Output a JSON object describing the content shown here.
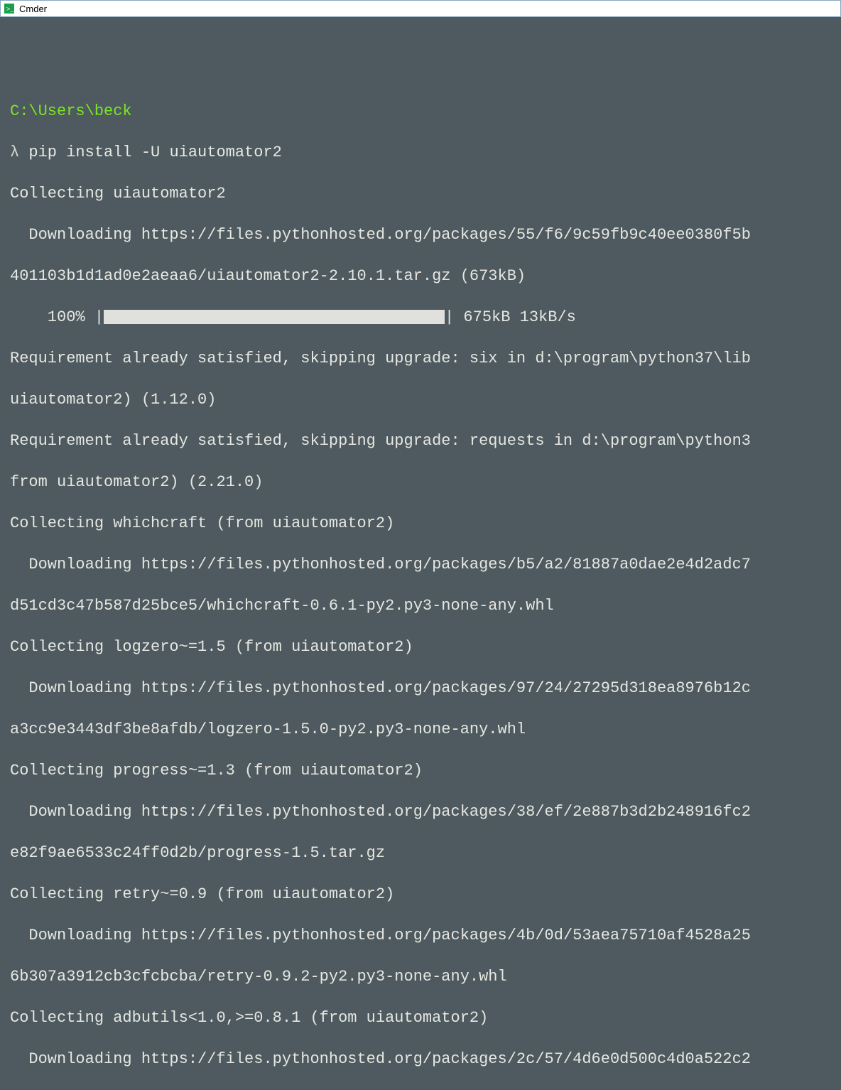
{
  "title_bar": {
    "app_name": "Cmder"
  },
  "terminal": {
    "path": "C:\\Users\\beck",
    "prompt_symbol": "λ",
    "command": "pip install -U uiautomator2",
    "lines": {
      "l0": "Collecting uiautomator2",
      "l1": "  Downloading https://files.pythonhosted.org/packages/55/f6/9c59fb9c40ee0380f5b",
      "l2": "401103b1d1ad0e2aeaa6/uiautomator2-2.10.1.tar.gz (673kB)",
      "progress_pct": "    100% |",
      "progress_tail": "| 675kB 13kB/s",
      "l3": "Requirement already satisfied, skipping upgrade: six in d:\\program\\python37\\lib",
      "l4": "uiautomator2) (1.12.0)",
      "l5": "Requirement already satisfied, skipping upgrade: requests in d:\\program\\python3",
      "l6": "from uiautomator2) (2.21.0)",
      "l7": "Collecting whichcraft (from uiautomator2)",
      "l8": "  Downloading https://files.pythonhosted.org/packages/b5/a2/81887a0dae2e4d2adc7",
      "l9": "d51cd3c47b587d25bce5/whichcraft-0.6.1-py2.py3-none-any.whl",
      "l10": "Collecting logzero~=1.5 (from uiautomator2)",
      "l11": "  Downloading https://files.pythonhosted.org/packages/97/24/27295d318ea8976b12c",
      "l12": "a3cc9e3443df3be8afdb/logzero-1.5.0-py2.py3-none-any.whl",
      "l13": "Collecting progress~=1.3 (from uiautomator2)",
      "l14": "  Downloading https://files.pythonhosted.org/packages/38/ef/2e887b3d2b248916fc2",
      "l15": "e82f9ae6533c24ff0d2b/progress-1.5.tar.gz",
      "l16": "Collecting retry~=0.9 (from uiautomator2)",
      "l17": "  Downloading https://files.pythonhosted.org/packages/4b/0d/53aea75710af4528a25",
      "l18": "6b307a3912cb3cfcbcba/retry-0.9.2-py2.py3-none-any.whl",
      "l19": "Collecting adbutils<1.0,>=0.8.1 (from uiautomator2)",
      "l20": "  Downloading https://files.pythonhosted.org/packages/2c/57/4d6e0d500c4d0a522c2"
    }
  }
}
